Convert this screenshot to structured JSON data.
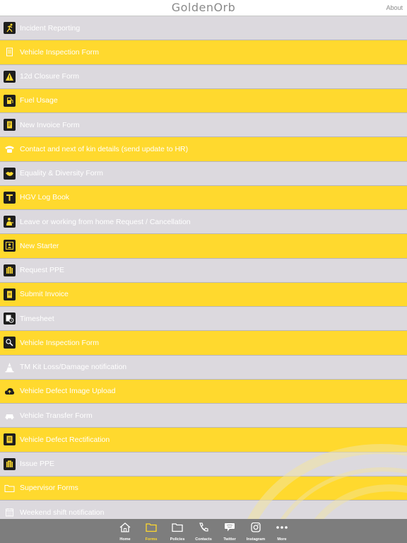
{
  "header": {
    "logo": "GoldenOrb",
    "about": "About"
  },
  "colors": {
    "yellow": "#ffd92e",
    "grey": "#dcd9de",
    "tabbar": "#7d7d7d"
  },
  "items": [
    {
      "label": "Incident Reporting",
      "icon": "running-person-icon"
    },
    {
      "label": "Vehicle Inspection Form",
      "icon": "document-icon"
    },
    {
      "label": "12d Closure Form",
      "icon": "warning-icon"
    },
    {
      "label": "Fuel Usage",
      "icon": "fuel-pump-icon"
    },
    {
      "label": "New Invoice Form",
      "icon": "invoice-icon"
    },
    {
      "label": "Contact and next of kin details (send update to HR)",
      "icon": "phone-icon"
    },
    {
      "label": "Equality & Diversity Form",
      "icon": "handshake-icon"
    },
    {
      "label": "HGV Log Book",
      "icon": "truck-icon"
    },
    {
      "label": "Leave or working from home Request / Cancellation",
      "icon": "person-leave-icon"
    },
    {
      "label": "New Starter",
      "icon": "new-starter-icon"
    },
    {
      "label": "Request PPE",
      "icon": "ppe-icon"
    },
    {
      "label": "Submit Invoice",
      "icon": "submit-invoice-icon"
    },
    {
      "label": "Timesheet",
      "icon": "clock-icon"
    },
    {
      "label": "Vehicle Inspection Form",
      "icon": "car-inspection-icon"
    },
    {
      "label": "TM Kit Loss/Damage notification",
      "icon": "traffic-cone-icon"
    },
    {
      "label": "Vehicle Defect Image Upload",
      "icon": "cloud-upload-icon"
    },
    {
      "label": "Vehicle Transfer Form",
      "icon": "car-icon"
    },
    {
      "label": "Vehicle Defect Rectification",
      "icon": "wrench-sheet-icon"
    },
    {
      "label": "Issue PPE",
      "icon": "issue-ppe-icon"
    },
    {
      "label": "Supervisor Forms",
      "icon": "folder-icon"
    },
    {
      "label": "Weekend shift notification",
      "icon": "calendar-icon"
    }
  ],
  "tabs": [
    {
      "label": "Home",
      "icon": "home-icon"
    },
    {
      "label": "Forms",
      "icon": "folder-icon",
      "active": true
    },
    {
      "label": "Policies",
      "icon": "folder-outline-icon"
    },
    {
      "label": "Contacts",
      "icon": "phone-icon"
    },
    {
      "label": "Twitter",
      "icon": "speech-bubble-icon"
    },
    {
      "label": "Instagram",
      "icon": "instagram-icon"
    },
    {
      "label": "More",
      "icon": "more-dots-icon"
    }
  ]
}
